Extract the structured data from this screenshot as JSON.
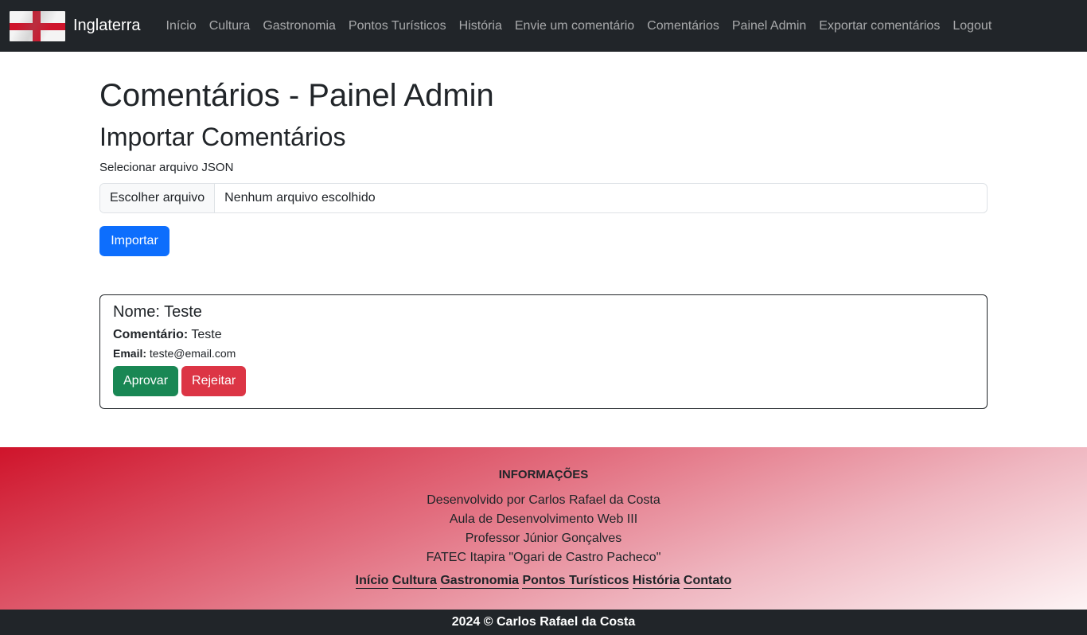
{
  "navbar": {
    "brand": "Inglaterra",
    "flag_icon": "england-flag-icon",
    "links": [
      "Início",
      "Cultura",
      "Gastronomia",
      "Pontos Turísticos",
      "História",
      "Envie um comentário",
      "Comentários",
      "Painel Admin",
      "Exportar comentários",
      "Logout"
    ]
  },
  "page": {
    "title": "Comentários - Painel Admin",
    "import_heading": "Importar Comentários",
    "file_label": "Selecionar arquivo JSON",
    "file_button": "Escolher arquivo",
    "file_status": "Nenhum arquivo escolhido",
    "import_button": "Importar"
  },
  "comment": {
    "name_line": "Nome: Teste",
    "comment_label": "Comentário:",
    "comment_value": "Teste",
    "email_label": "Email:",
    "email_value": "teste@email.com",
    "approve_button": "Aprovar",
    "reject_button": "Rejeitar"
  },
  "footer": {
    "title": "INFORMAÇÕES",
    "lines": [
      "Desenvolvido por Carlos Rafael da Costa",
      "Aula de Desenvolvimento Web III",
      "Professor Júnior Gonçalves",
      "FATEC Itapira \"Ogari de Castro Pacheco\""
    ],
    "links": [
      "Início",
      "Cultura",
      "Gastronomia",
      "Pontos Turísticos",
      "História",
      "Contato"
    ],
    "copyright": "2024 © Carlos Rafael da Costa"
  },
  "colors": {
    "navbar": "#212529",
    "primary": "#0d6efd",
    "success": "#198754",
    "danger": "#dc3545",
    "footer_accent": "#cf142b"
  }
}
